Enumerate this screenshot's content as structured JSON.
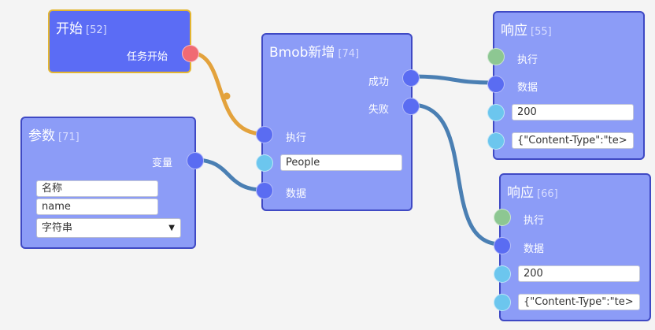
{
  "nodes": {
    "start": {
      "title": "开始",
      "id": "[52]",
      "output_label": "任务开始"
    },
    "param": {
      "title": "参数",
      "id": "[71]",
      "output_label": "变量",
      "name_label": "名称",
      "name_value": "name",
      "type_value": "字符串"
    },
    "bmob": {
      "title": "Bmob新增",
      "id": "[74]",
      "success_label": "成功",
      "fail_label": "失败",
      "exec_label": "执行",
      "table_value": "People",
      "data_label": "数据"
    },
    "resp1": {
      "title": "响应",
      "id": "[55]",
      "exec_label": "执行",
      "data_label": "数据",
      "status_value": "200",
      "headers_value": "{\"Content-Type\":\"te>"
    },
    "resp2": {
      "title": "响应",
      "id": "[66]",
      "exec_label": "执行",
      "data_label": "数据",
      "status_value": "200",
      "headers_value": "{\"Content-Type\":\"te>"
    }
  },
  "colors": {
    "node_bg": "#8c9cf7",
    "node_border": "#3f49c4",
    "start_bg": "#5b6cf5",
    "start_border": "#e3b530",
    "exec_wire": "#e3a23c",
    "data_wire": "#4a7fb3",
    "port_blue": "#5a6cf2",
    "port_red": "#f06a73",
    "port_green": "#8dc792",
    "port_cyan": "#6cc6ee"
  }
}
